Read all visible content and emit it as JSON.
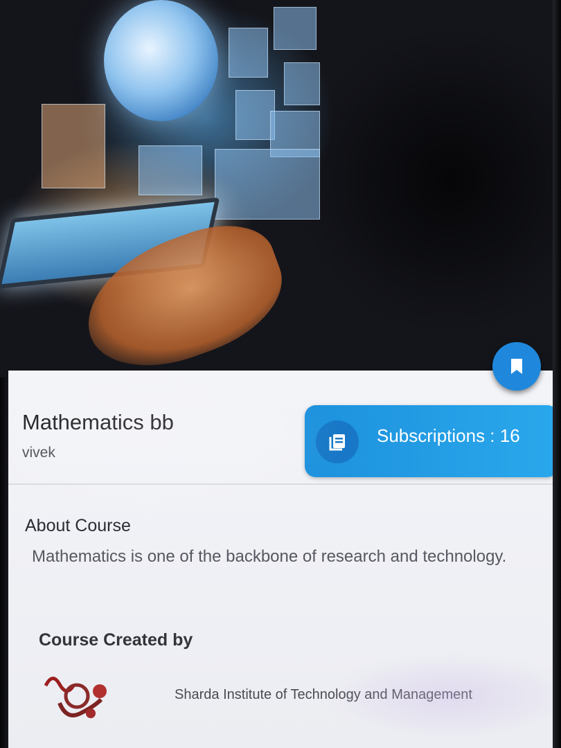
{
  "course": {
    "title": "Mathematics bb",
    "author": "vivek",
    "subscriptions_label": "Subscriptions : 16"
  },
  "about": {
    "heading": "About Course",
    "description": "Mathematics is one of the backbone of research and technology."
  },
  "creator": {
    "heading": "Course Created by",
    "name": "Sharda Institute of Technology and Management"
  },
  "icons": {
    "bookmark": "bookmark-icon",
    "subscriptions": "library-books-icon",
    "creator_logo": "institute-logo"
  },
  "colors": {
    "accent": "#1f88dc",
    "button": "#2aa8ec",
    "card_bg": "#f3f4f8"
  }
}
